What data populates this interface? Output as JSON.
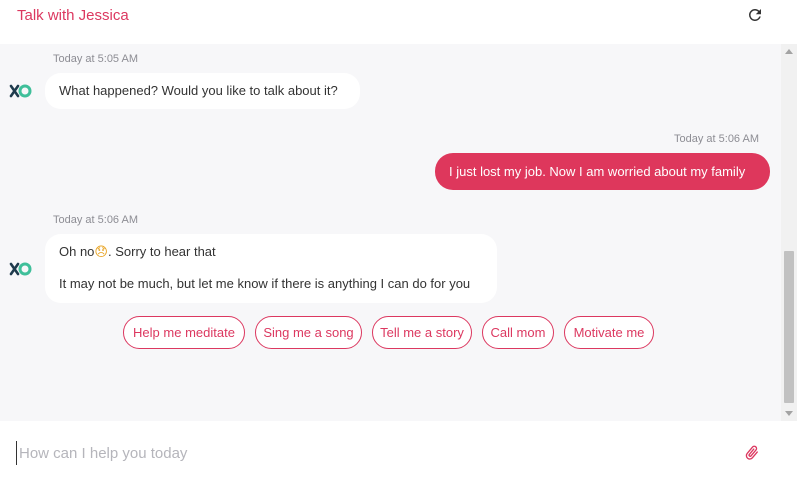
{
  "header": {
    "title": "Talk with Jessica",
    "refresh_icon": "refresh-icon"
  },
  "messages": [
    {
      "sender": "bot",
      "timestamp": "Today at 5:05 AM",
      "lines": [
        "What happened? Would you like to talk about it?"
      ]
    },
    {
      "sender": "user",
      "timestamp": "Today at 5:06 AM",
      "lines": [
        "I just lost my job. Now I am worried about my family"
      ]
    },
    {
      "sender": "bot",
      "timestamp": "Today at 5:06 AM",
      "lines": [
        "Oh no",
        ". Sorry to hear that",
        "It may not be much, but let me know if there is anything I can do for you"
      ],
      "emoji": "😞"
    }
  ],
  "quick_replies": [
    "Help me meditate",
    "Sing me a song",
    "Tell me a story",
    "Call mom",
    "Motivate me"
  ],
  "input": {
    "placeholder": "How can I help you today",
    "value": ""
  },
  "colors": {
    "accent": "#dc3860",
    "user_bubble": "#de375c",
    "chat_bg": "#f7f7f9",
    "bot_logo_dark": "#1f3b4d",
    "bot_logo_teal": "#3fbf9a"
  },
  "icons": {
    "bot_avatar": "bot-logo-icon",
    "attach": "paperclip-icon"
  }
}
